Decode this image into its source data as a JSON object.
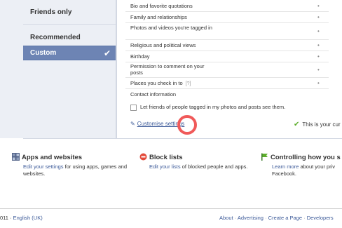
{
  "left_menu": {
    "friends_only": "Friends only",
    "recommended": "Recommended",
    "custom": "Custom"
  },
  "info_rows": [
    {
      "label": "Bio and favorite quotations",
      "marker": "•"
    },
    {
      "label": "Family and relationships",
      "marker": "•"
    },
    {
      "label": "Photos and videos you're tagged in",
      "marker": "•"
    },
    {
      "label": "Religious and political views",
      "marker": "•"
    },
    {
      "label": "Birthday",
      "marker": "•"
    },
    {
      "label": "Permission to comment on your posts",
      "marker": "•"
    },
    {
      "label": "Places you check in to",
      "help": "[?]",
      "marker": "•"
    },
    {
      "label": "Contact information",
      "marker": ""
    }
  ],
  "checkbox_label": "Let friends of people tagged in my photos and posts see them.",
  "customise_link": "Customise settings",
  "status_text": "This is your cur",
  "sections": {
    "apps": {
      "title": "Apps and websites",
      "link": "Edit your settings",
      "text": " for using apps, games and websites."
    },
    "block": {
      "title": "Block lists",
      "link": "Edit your lists",
      "text": " of blocked people and apps."
    },
    "control": {
      "title": "Controlling how you s",
      "link": "Learn more",
      "text": " about your priv Facebook."
    }
  },
  "footer": {
    "copyright_prefix": "011 · ",
    "language": "English (UK)",
    "links": [
      "About",
      "Advertising",
      "Create a Page",
      "Developers"
    ],
    "separator": " · "
  },
  "colors": {
    "link": "#3b5998",
    "selected": "#6d84b4",
    "highlight_circle": "#f05a5a",
    "success": "#5dae2c"
  }
}
